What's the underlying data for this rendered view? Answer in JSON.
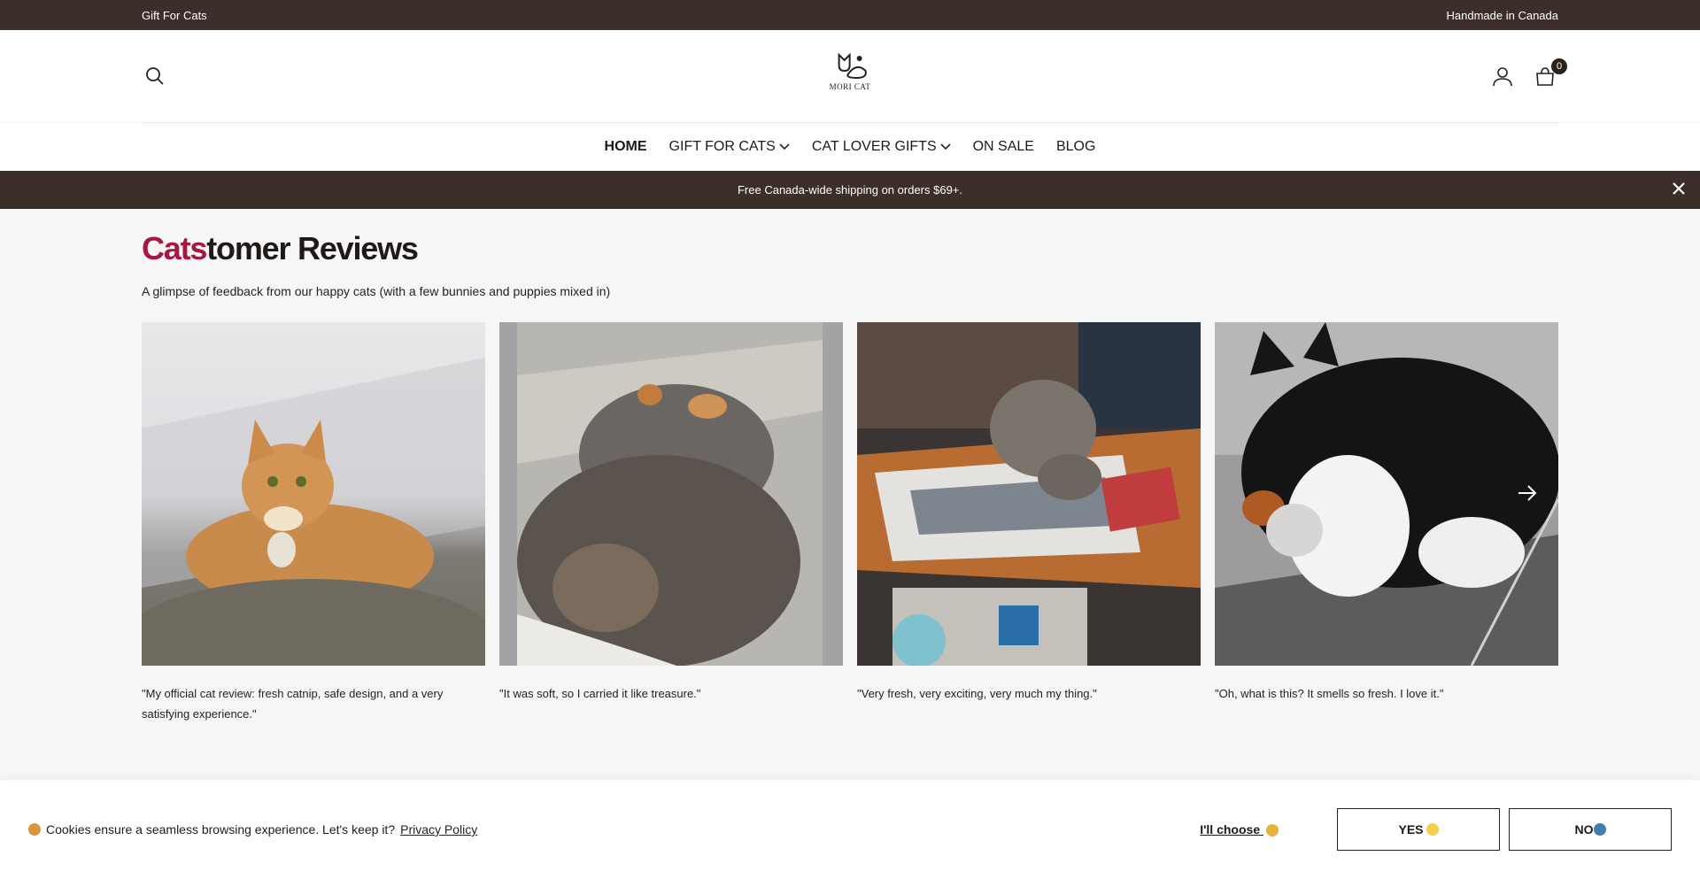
{
  "topbar": {
    "left": "Gift For Cats",
    "right": "Handmade in Canada"
  },
  "header": {
    "logo_text": "MORI CAT",
    "cart_count": "0"
  },
  "nav": [
    {
      "label": "HOME",
      "active": true,
      "dropdown": false
    },
    {
      "label": "GIFT FOR CATS",
      "active": false,
      "dropdown": true
    },
    {
      "label": "CAT LOVER GIFTS",
      "active": false,
      "dropdown": true
    },
    {
      "label": "ON SALE",
      "active": false,
      "dropdown": false
    },
    {
      "label": "BLOG",
      "active": false,
      "dropdown": false
    }
  ],
  "announcement": {
    "text": "Free Canada-wide shipping on orders $69+."
  },
  "reviews": {
    "title_accent": "Cats",
    "title_rest": "tomer Reviews",
    "subtitle": "A glimpse of feedback from our happy cats (with a few bunnies and puppies mixed in)",
    "items": [
      {
        "caption": "\"My official cat review: fresh catnip, safe design, and a very satisfying experience.\""
      },
      {
        "caption": "\"It was soft, so I carried it like treasure.\""
      },
      {
        "caption": "\"Very fresh, very exciting, very much my thing.\""
      },
      {
        "caption": "\"Oh, what is this? It smells so fresh. I love it.\""
      }
    ]
  },
  "cookie": {
    "message": "Cookies ensure a seamless browsing experience. Let's keep it?",
    "link": "Privacy Policy",
    "choose": "I'll choose",
    "yes": "YES",
    "no": "NO"
  },
  "colors": {
    "brown": "#3c2f29",
    "accent": "#a5183f"
  }
}
